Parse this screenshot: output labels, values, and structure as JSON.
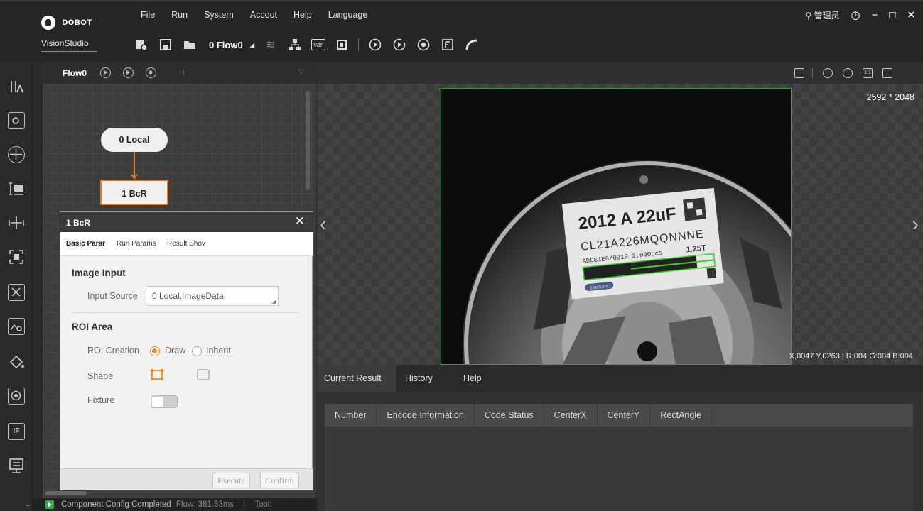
{
  "app": {
    "logo_text": "DOBOT",
    "product_name": "VisionStudio"
  },
  "menu": [
    "File",
    "Run",
    "System",
    "Accout",
    "Help",
    "Language"
  ],
  "toolbar": {
    "flow_label": "0 Flow0"
  },
  "window": {
    "user_label": "管理员"
  },
  "flow_panel": {
    "tab_label": "Flow0",
    "nodes": [
      {
        "label": "0 Local"
      },
      {
        "label": "1 BcR"
      }
    ]
  },
  "dialog": {
    "title": "1 BcR",
    "tabs": [
      "Basic Parar",
      "Run Params",
      "Result Shov"
    ],
    "image_input": {
      "section_title": "Image Input",
      "input_source_label": "Input Source",
      "input_source_value": "0 Local.ImageData"
    },
    "roi": {
      "section_title": "ROI Area",
      "creation_label": "ROI Creation",
      "option_draw": "Draw",
      "option_inherit": "Inherit",
      "selected": "Draw",
      "shape_label": "Shape",
      "fixture_label": "Fixture",
      "fixture_enabled": false
    },
    "buttons": {
      "execute": "Execute",
      "confirm": "Confirm"
    }
  },
  "status": {
    "dots": "..",
    "message": "Component Config Completed",
    "flow_label": "Flow:",
    "flow_time": "381.53ms",
    "tool_label": "Tool:"
  },
  "image_view": {
    "resolution": "2592 * 2048",
    "pixel_readout": "X,0047  Y,0263  |  R:004  G:004  B:004",
    "label": {
      "line1": "2012 A  22uF",
      "line2": "CL21A226MQQNNNE",
      "line3": "ADCS1E6/0219 2.000pcs",
      "line3b": "1.25T",
      "brand": "SAMSUNG"
    }
  },
  "results": {
    "tabs": [
      "Current Result",
      "History",
      "Help"
    ],
    "active_tab": "Current Result",
    "columns": [
      "Number",
      "Encode Information",
      "Code Status",
      "CenterX",
      "CenterY",
      "RectAngle"
    ]
  },
  "colors": {
    "accent": "#e0782a",
    "radio_on": "#f08a24",
    "roi_border": "#4a9f2a",
    "status_ok": "#2fa84f"
  }
}
